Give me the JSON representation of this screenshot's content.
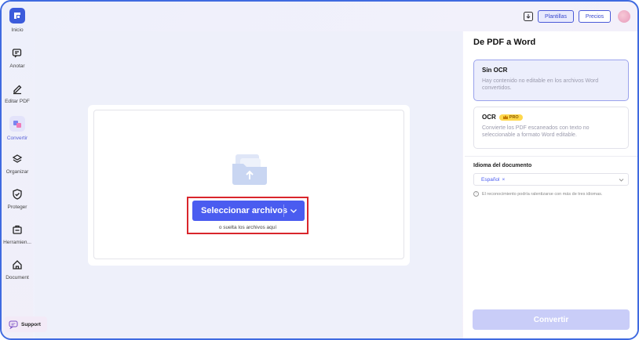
{
  "sidebar": {
    "items": [
      {
        "label": "Inicio"
      },
      {
        "label": "Anotar"
      },
      {
        "label": "Editar PDF"
      },
      {
        "label": "Convertir"
      },
      {
        "label": "Organizar"
      },
      {
        "label": "Proteger"
      },
      {
        "label": "Herramien..."
      },
      {
        "label": "Document"
      }
    ],
    "support_label": "Support"
  },
  "topbar": {
    "templates_label": "Plantillas",
    "prices_label": "Precios"
  },
  "main": {
    "select_button_label": "Seleccionar archivos",
    "drop_hint": "o suelta los archivos aquí"
  },
  "panel": {
    "title": "De PDF a Word",
    "options": [
      {
        "title": "Sin OCR",
        "description": "Hay contenido no editable en los archivos Word convertidos.",
        "selected": true
      },
      {
        "title": "OCR",
        "badge": "PRO",
        "description": "Convierte los PDF escaneados con texto no seleccionable a formato Word editable.",
        "selected": false
      }
    ],
    "language_title": "Idioma del documento",
    "language_tag": "Español",
    "language_tag_remove": "×",
    "warning": "El reconocimiento podría ralentizarse con más de tres idiomas.",
    "warning_icon_glyph": "!",
    "convert_label": "Convertir"
  },
  "colors": {
    "accent": "#4a5cf0",
    "highlight_border": "#d9262c",
    "frame_border": "#3f6ae0"
  }
}
